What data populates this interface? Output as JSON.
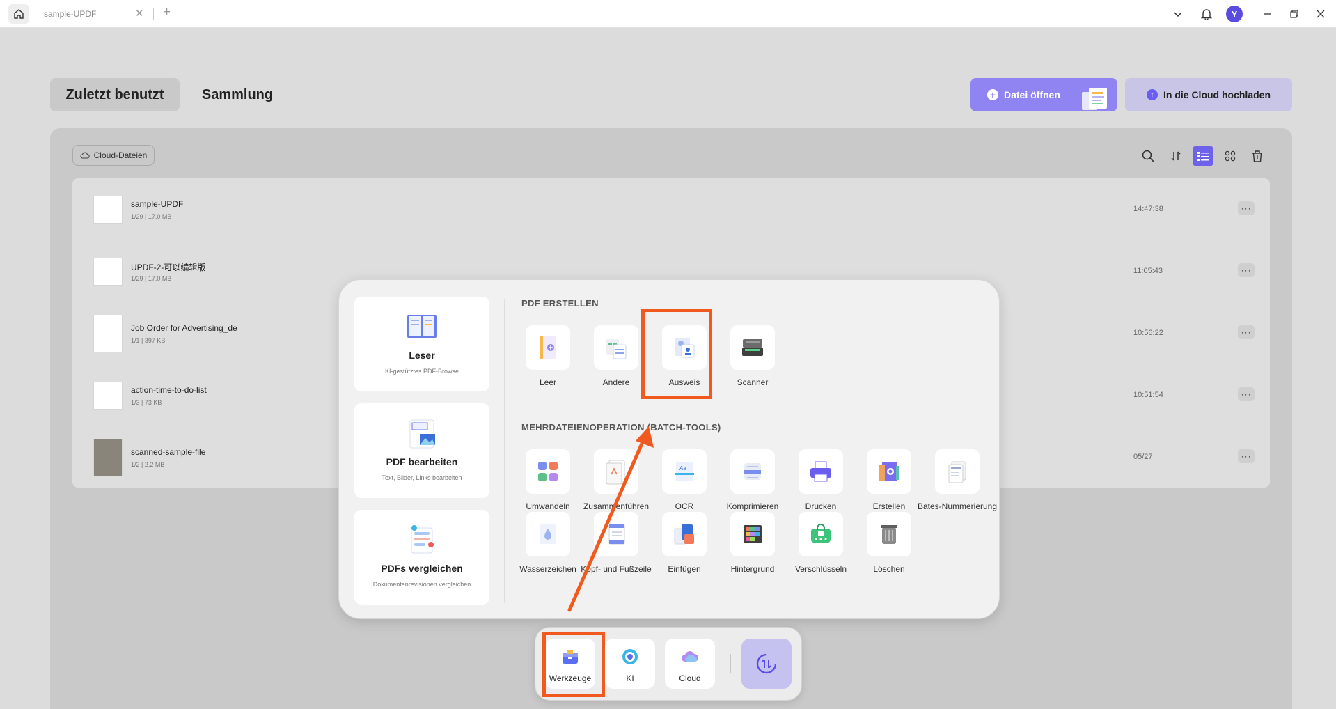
{
  "titlebar": {
    "tab_title": "sample-UPDF",
    "avatar_letter": "Y"
  },
  "header": {
    "tab_recent": "Zuletzt benutzt",
    "tab_collection": "Sammlung",
    "open_file": "Datei öffnen",
    "upload_cloud": "In die Cloud hochladen"
  },
  "panel": {
    "cloud_chip": "Cloud-Dateien"
  },
  "files": [
    {
      "name": "sample-UPDF",
      "meta": "1/29 | 17.0 MB",
      "time": "14:47:38"
    },
    {
      "name": "UPDF-2-可以编辑版",
      "meta": "1/29 | 17.0 MB",
      "time": "11:05:43"
    },
    {
      "name": "Job Order for Advertising_de",
      "meta": "1/1 | 397 KB",
      "time": "10:56:22"
    },
    {
      "name": "action-time-to-do-list",
      "meta": "1/3 | 73 KB",
      "time": "10:51:54"
    },
    {
      "name": "scanned-sample-file",
      "meta": "1/2 | 2.2 MB",
      "time": "05/27"
    }
  ],
  "popup": {
    "cards": [
      {
        "title": "Leser",
        "subtitle": "KI-gestütztes PDF-Browse"
      },
      {
        "title": "PDF bearbeiten",
        "subtitle": "Text, Bilder, Links bearbeiten"
      },
      {
        "title": "PDFs vergleichen",
        "subtitle": "Dokumentenrevisionen vergleichen"
      }
    ],
    "section_create": "PDF ERSTELLEN",
    "create_tools": [
      "Leer",
      "Andere",
      "Ausweis",
      "Scanner"
    ],
    "section_batch": "MEHRDATEIENOPERATION (BATCH-TOOLS)",
    "batch_row1": [
      "Umwandeln",
      "Zusammenführen",
      "OCR",
      "Komprimieren",
      "Drucken",
      "Erstellen",
      "Bates-Nummerierung"
    ],
    "batch_row2": [
      "Wasserzeichen",
      "Kopf- und Fußzeile",
      "Einfügen",
      "Hintergrund",
      "Verschlüsseln",
      "Löschen"
    ]
  },
  "dock": {
    "tools": "Werkzeuge",
    "ai": "KI",
    "cloud": "Cloud"
  },
  "colors": {
    "accent": "#8f84f2",
    "highlight": "#f15a1f"
  }
}
